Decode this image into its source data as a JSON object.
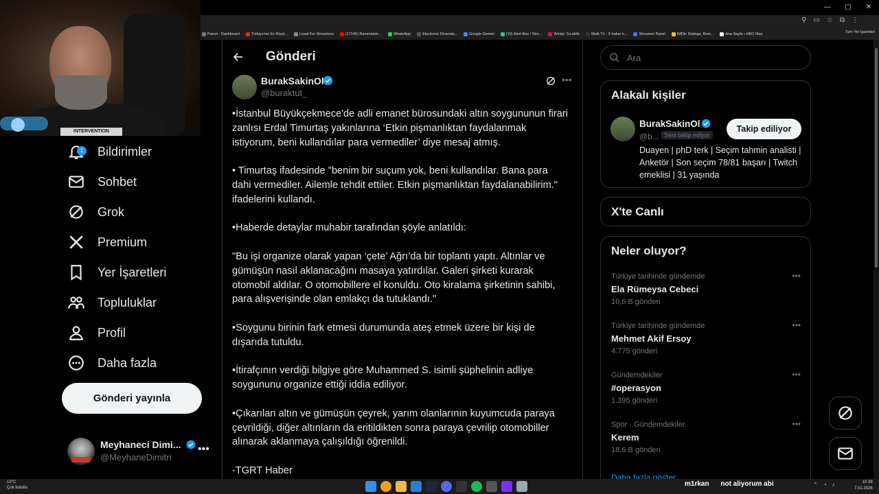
{
  "browser": {
    "window_controls": [
      "—",
      "▢",
      "✕"
    ],
    "bookmarks": [
      {
        "label": "Parrot - Dashboard",
        "color": "#7a7a7a"
      },
      {
        "label": "Türkiye'nin En Büyü...",
        "color": "#d93025"
      },
      {
        "label": "Livad For Streamers",
        "color": "#888888"
      },
      {
        "label": "(17145) Rammstein...",
        "color": "#ff0000"
      },
      {
        "label": "WhatsApp",
        "color": "#25d366"
      },
      {
        "label": "Electronic Diversity...",
        "color": "#555555"
      },
      {
        "label": "Google Gemini",
        "color": "#4285f4"
      },
      {
        "label": "(19) Alert Box / Stre...",
        "color": "#31c3a2"
      },
      {
        "label": "Windy: Sıcaklık",
        "color": "#c2185b"
      },
      {
        "label": "Multi TV - 6 haber k...",
        "color": "#333333"
      },
      {
        "label": "Streamer Panel",
        "color": "#5865f2"
      },
      {
        "label": "IMDb: Ratings, Revi...",
        "color": "#f5c518"
      },
      {
        "label": "Ana Sayfa • HBO Max",
        "color": "#ffffff"
      }
    ],
    "all_bookmarks": "Tüm Yer İşaretleri"
  },
  "webcam": {
    "shirt_text": "INTERVENTION"
  },
  "nav": {
    "items": [
      {
        "label": "Bildirimler",
        "icon": "bell-icon",
        "badge": "1"
      },
      {
        "label": "Sohbet",
        "icon": "mail-icon"
      },
      {
        "label": "Grok",
        "icon": "grok-icon"
      },
      {
        "label": "Premium",
        "icon": "x-logo-icon"
      },
      {
        "label": "Yer İşaretleri",
        "icon": "bookmark-icon"
      },
      {
        "label": "Topluluklar",
        "icon": "communities-icon"
      },
      {
        "label": "Profil",
        "icon": "person-icon"
      },
      {
        "label": "Daha fazla",
        "icon": "more-circle-icon"
      }
    ],
    "post_button": "Gönderi yayınla",
    "account": {
      "name": "Meyhaneci Dimi...",
      "handle": "@MeyhaneDimitri"
    }
  },
  "post": {
    "page_title": "Gönderi",
    "author_name": "BurakSakinOl",
    "author_handle": "@buraktut_",
    "paragraphs": [
      "•İstanbul Büyükçekmece'de adli emanet bürosundaki altın soygununun firari zanlısı Erdal Timurtaş yakınlarına ‘Etkin pişmanlıktan faydalanmak istiyorum, beni kullandılar para vermediler’ diye mesaj atmış.",
      "• Timurtaş ifadesinde \"benim bir suçum yok, beni kullandılar. Bana para dahi vermediler. Ailemle tehdit ettiler. Etkin pişmanlıktan faydalanabilirim.\" ifadelerini kullandı.",
      "•Haberde detaylar muhabir tarafından şöyle anlatıldı:",
      "\"Bu işi organize olarak yapan ‘çete’ Ağrı’da bir toplantı yaptı. Altınlar ve gümüşün nasıl aklanacağını masaya yatırdılar. Galeri şirketi kurarak otomobil aldılar. O otomobillere el konuldu. Oto kiralama şirketinin sahibi, para alışverişinde olan emlakçı da tutuklandı.\"",
      "•Soygunu birinin fark etmesi durumunda ateş etmek üzere bir kişi de dışarıda tutuldu.",
      "•İtirafçının verdiği bilgiye göre Muhammed S. isimli şüphelinin adliye soygununu organize ettiği iddia ediliyor.",
      "•Çıkarılan altın ve gümüşün çeyrek, yarım olanlarının kuyumcuda paraya çevrildiği, diğer altınların da eritildikten sonra paraya çevrilip otomobiller alınarak aklanmaya çalışıldığı öğrenildi.",
      "-TGRT Haber"
    ]
  },
  "sidebar": {
    "search_placeholder": "Ara",
    "related": {
      "title": "Alakalı kişiler",
      "name": "BurakSakinOl",
      "handle": "@b...",
      "follows_you": "Seni takip ediyor",
      "follow_button": "Takip ediliyor",
      "bio": "Duayen | phD terk | Seçim tahmin analisti | Anketör | Son seçim 78/81 başarı | Twitch emeklisi | 31 yaşında"
    },
    "live_title": "X'te Canlı",
    "trends_title": "Neler oluyor?",
    "trends": [
      {
        "context": "Türkiye tarihinde gündemde",
        "name": "Ela Rümeysa Cebeci",
        "count": "10,6 B gönderi"
      },
      {
        "context": "Türkiye tarihinde gündemde",
        "name": "Mehmet Akif Ersoy",
        "count": "4.775 gönderi"
      },
      {
        "context": "Gündemdekiler",
        "name": "#operasyon",
        "count": "1.395 gönderi"
      },
      {
        "context": "Spor · Gündemdekiler",
        "name": "Kerem",
        "count": "18,6 B gönderi"
      }
    ],
    "show_more": "Daha fazla göster"
  },
  "taskbar": {
    "weather_temp": "13°C",
    "weather_desc": "Çok bulutlu",
    "chat_user": "m1rkan",
    "chat_message": "not aliyorum abi",
    "time": "10:39",
    "date": "7.01.2026"
  },
  "colors": {
    "accent": "#1d9bf0",
    "background": "#000000",
    "border": "#2f3336",
    "muted": "#71767b"
  }
}
